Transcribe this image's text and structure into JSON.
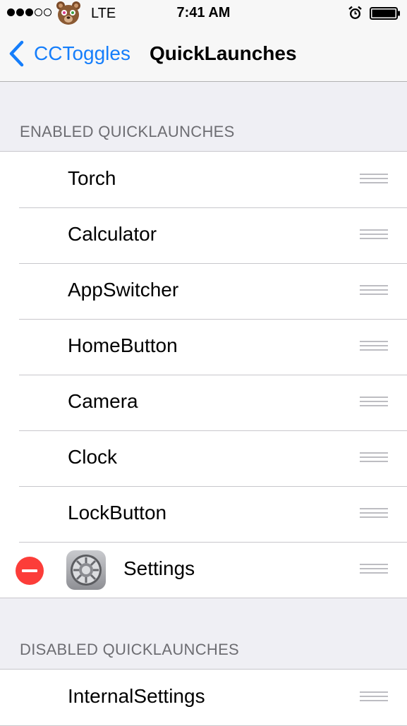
{
  "status_bar": {
    "carrier": "LTE",
    "time": "7:41 AM",
    "signal_dots_filled": 3,
    "signal_dots_total": 5,
    "icons": [
      "bear-icon",
      "alarm-icon",
      "battery-icon"
    ]
  },
  "nav": {
    "back_label": "CCToggles",
    "title": "QuickLaunches"
  },
  "enabled_section": {
    "header": "ENABLED QUICKLAUNCHES",
    "items": [
      {
        "label": "Torch"
      },
      {
        "label": "Calculator"
      },
      {
        "label": "AppSwitcher"
      },
      {
        "label": "HomeButton"
      },
      {
        "label": "Camera"
      },
      {
        "label": "Clock"
      },
      {
        "label": "LockButton"
      },
      {
        "label": "Settings",
        "icon": "settings-gear-icon",
        "deletable": true
      }
    ]
  },
  "disabled_section": {
    "header": "DISABLED QUICKLAUNCHES",
    "items": [
      {
        "label": "InternalSettings"
      }
    ]
  },
  "colors": {
    "accent": "#157efb",
    "delete": "#fc3d39",
    "background": "#efeff4",
    "header_text": "#6d6d72"
  }
}
